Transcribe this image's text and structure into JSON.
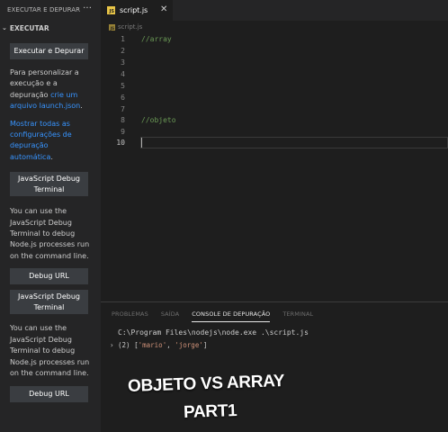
{
  "sidebar": {
    "header": "EXECUTAR E DEPURAR",
    "more_icon": "···",
    "section_title": "EXECUTAR",
    "run_debug_button": "Executar e Depurar",
    "customize_text": "Para personalizar a execução e a depuração ",
    "customize_link": "crie um arquivo launch.json",
    "customize_text_end": ".",
    "show_all_link": "Mostrar todas as configurações de depuração automática",
    "show_all_end": ".",
    "js_debug_terminal_1": "JavaScript Debug Terminal",
    "terminal_text_1": "You can use the JavaScript Debug Terminal to debug Node.js processes run on the command line.",
    "debug_url_1": "Debug URL",
    "js_debug_terminal_2": "JavaScript Debug Terminal",
    "terminal_text_2": "You can use the JavaScript Debug Terminal to debug Node.js processes run on the command line.",
    "debug_url_2": "Debug URL"
  },
  "editor": {
    "tab_label": "script.js",
    "tab_icon": "JS",
    "close_icon": "✕",
    "breadcrumb": "script.js",
    "lines": [
      {
        "n": "1",
        "code": "//array"
      },
      {
        "n": "2",
        "code": ""
      },
      {
        "n": "3",
        "code": ""
      },
      {
        "n": "4",
        "code": ""
      },
      {
        "n": "5",
        "code": ""
      },
      {
        "n": "6",
        "code": ""
      },
      {
        "n": "7",
        "code": ""
      },
      {
        "n": "8",
        "code": "//objeto"
      },
      {
        "n": "9",
        "code": ""
      },
      {
        "n": "10",
        "code": ""
      }
    ],
    "active_line": 10
  },
  "panel": {
    "tabs": [
      "PROBLEMAS",
      "SAÍDA",
      "CONSOLE DE DEPURAÇÃO",
      "TERMINAL"
    ],
    "active_tab": "CONSOLE DE DEPURAÇÃO",
    "command": "C:\\Program Files\\nodejs\\node.exe .\\script.js",
    "output_prefix": "(2) [",
    "output_items": [
      "'mario'",
      "'jorge'"
    ],
    "output_suffix": "]",
    "expand_icon": "›"
  },
  "overlay": {
    "line1": "OBJETO VS ARRAY",
    "line2": "PART1"
  },
  "colors": {
    "sidebar_bg": "#252526",
    "editor_bg": "#1e1e1e",
    "comment": "#6a9955",
    "link": "#3794ff",
    "button_bg": "#3a3d41",
    "js_icon": "#e8c547"
  }
}
